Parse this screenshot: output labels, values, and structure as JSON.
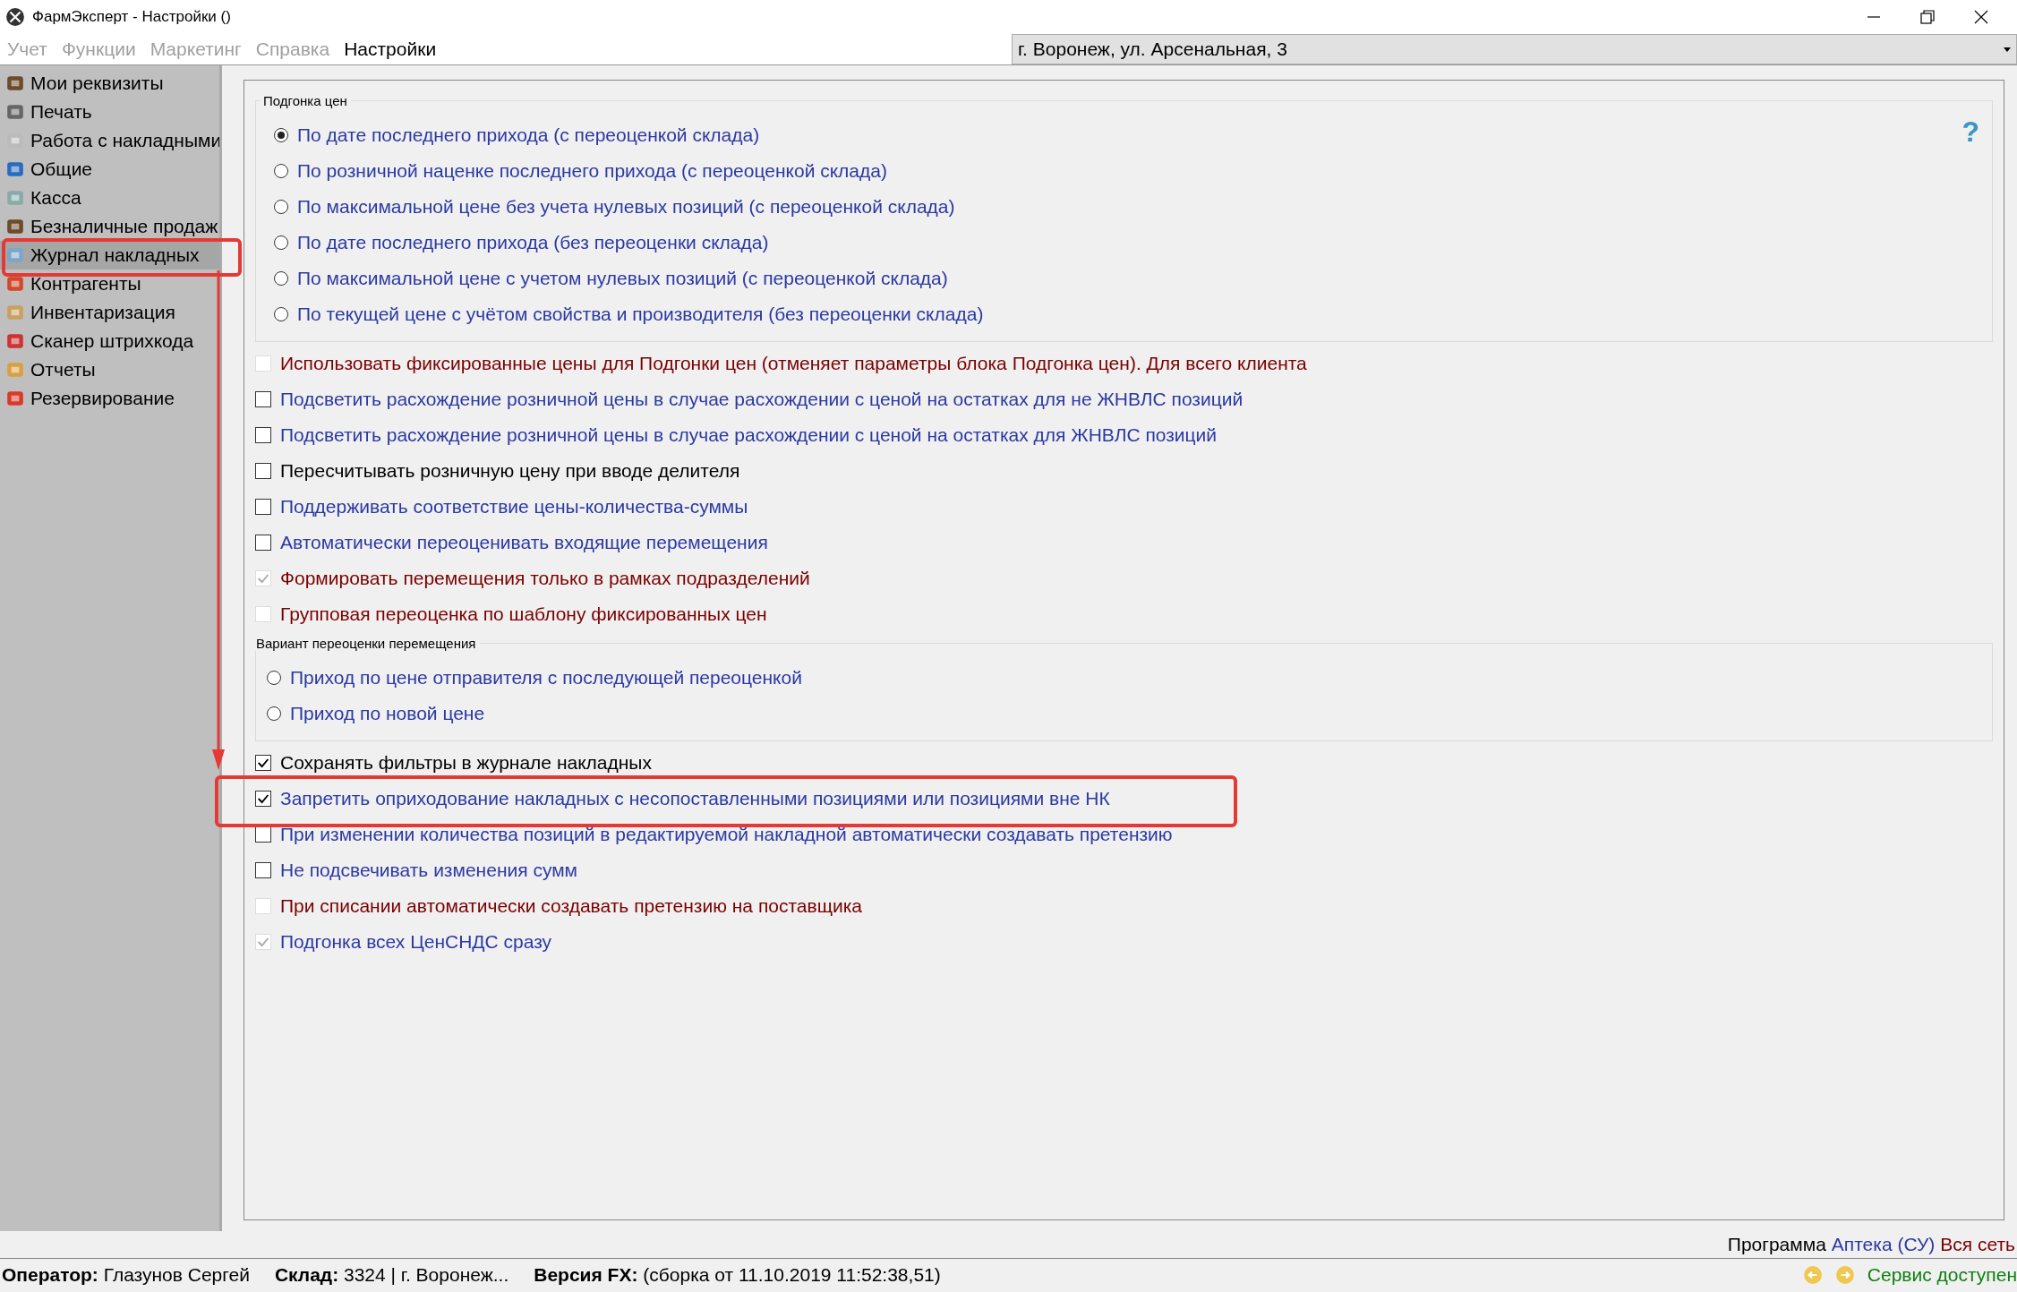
{
  "window": {
    "title": "ФармЭксперт - Настройки ()"
  },
  "menu": [
    {
      "label": "Учет",
      "disabled": true
    },
    {
      "label": "Функции",
      "disabled": true
    },
    {
      "label": "Маркетинг",
      "disabled": true
    },
    {
      "label": "Справка",
      "disabled": true
    },
    {
      "label": "Настройки",
      "disabled": false
    }
  ],
  "store_select": {
    "value": "г. Воронеж, ул. Арсенальная, 3"
  },
  "sidebar": {
    "items": [
      {
        "label": "Мои реквизиты",
        "selected": false
      },
      {
        "label": "Печать",
        "selected": false
      },
      {
        "label": "Работа с накладными",
        "selected": false
      },
      {
        "label": "Общие",
        "selected": false
      },
      {
        "label": "Касса",
        "selected": false
      },
      {
        "label": "Безналичные продаж",
        "selected": false
      },
      {
        "label": "Журнал накладных",
        "selected": true
      },
      {
        "label": "Контрагенты",
        "selected": false
      },
      {
        "label": "Инвентаризация",
        "selected": false
      },
      {
        "label": "Сканер штрихкода",
        "selected": false
      },
      {
        "label": "Отчеты",
        "selected": false
      },
      {
        "label": "Резервирование",
        "selected": false
      }
    ]
  },
  "help_button": {
    "label": "?"
  },
  "price_group": {
    "title": "Подгонка цен",
    "options": [
      {
        "label": "По дате последнего прихода (с переоценкой склада)",
        "selected": true
      },
      {
        "label": "По розничной наценке последнего прихода (с переоценкой склада)",
        "selected": false
      },
      {
        "label": "По максимальной цене без учета нулевых позиций (с переоценкой склада)",
        "selected": false
      },
      {
        "label": "По дате последнего прихода (без переоценки склада)",
        "selected": false
      },
      {
        "label": "По максимальной цене с учетом нулевых позиций (с переоценкой склада)",
        "selected": false
      },
      {
        "label": "По текущей цене с учётом свойства и производителя (без переоценки склада)",
        "selected": false
      }
    ]
  },
  "checkboxes_a": [
    {
      "label": "Использовать фиксированные цены для Подгонки цен (отменяет параметры блока Подгонка цен). Для всего клиента",
      "checked": false,
      "disabled": true,
      "color": "#7a0000"
    },
    {
      "label": "Подсветить расхождение розничной цены в случае расхождении с ценой на остатках для не ЖНВЛС позиций",
      "checked": false,
      "disabled": false,
      "color": "#2b39a3"
    },
    {
      "label": "Подсветить расхождение розничной цены в случае расхождении с ценой на остатках для ЖНВЛС позиций",
      "checked": false,
      "disabled": false,
      "color": "#2b39a3"
    },
    {
      "label": "Пересчитывать розничную цену при вводе делителя",
      "checked": false,
      "disabled": false,
      "color": "#000000"
    },
    {
      "label": "Поддерживать соответствие цены-количества-суммы",
      "checked": false,
      "disabled": false,
      "color": "#2b39a3"
    },
    {
      "label": "Автоматически переоценивать входящие перемещения",
      "checked": false,
      "disabled": false,
      "color": "#2b39a3"
    },
    {
      "label": "Формировать перемещения только в рамках подразделений",
      "checked": true,
      "disabled": true,
      "color": "#7a0000"
    },
    {
      "label": "Групповая переоценка по шаблону фиксированных цен",
      "checked": false,
      "disabled": true,
      "color": "#7a0000"
    }
  ],
  "transfer_group": {
    "title": "Вариант переоценки перемещения",
    "options": [
      {
        "label": "Приход по цене отправителя с последующей переоценкой",
        "selected": false
      },
      {
        "label": "Приход по новой цене",
        "selected": false
      }
    ]
  },
  "checkboxes_b": [
    {
      "label": "Сохранять фильтры в журнале накладных",
      "checked": true,
      "disabled": false,
      "color": "#000000"
    },
    {
      "label": "Запретить оприходование накладных с несопоставленными позициями или позициями вне НК",
      "checked": true,
      "disabled": false,
      "color": "#2b39a3"
    },
    {
      "label": "При изменении количества позиций в редактируемой накладной автоматически создавать претензию",
      "checked": false,
      "disabled": false,
      "color": "#2b39a3"
    },
    {
      "label": "Не подсвечивать изменения сумм",
      "checked": false,
      "disabled": false,
      "color": "#2b39a3"
    },
    {
      "label": "При списании автоматически создавать претензию на поставщика",
      "checked": false,
      "disabled": true,
      "color": "#7a0000"
    },
    {
      "label": "Подгонка всех ЦенСНДС сразу",
      "checked": true,
      "disabled": true,
      "color": "#2b39a3"
    }
  ],
  "program_line": {
    "label": "Программа",
    "name": "Аптека (СУ)",
    "scope": "Вся сеть"
  },
  "status_bar": {
    "fields": [
      {
        "label": "Оператор:",
        "value": "Глазунов Сергей"
      },
      {
        "label": "Склад:",
        "value": "3324 | г. Воронеж..."
      },
      {
        "label": "Версия FX:",
        "value": "(сборка от 11.10.2019 11:52:38,51)"
      }
    ],
    "service": "Сервис доступен"
  }
}
